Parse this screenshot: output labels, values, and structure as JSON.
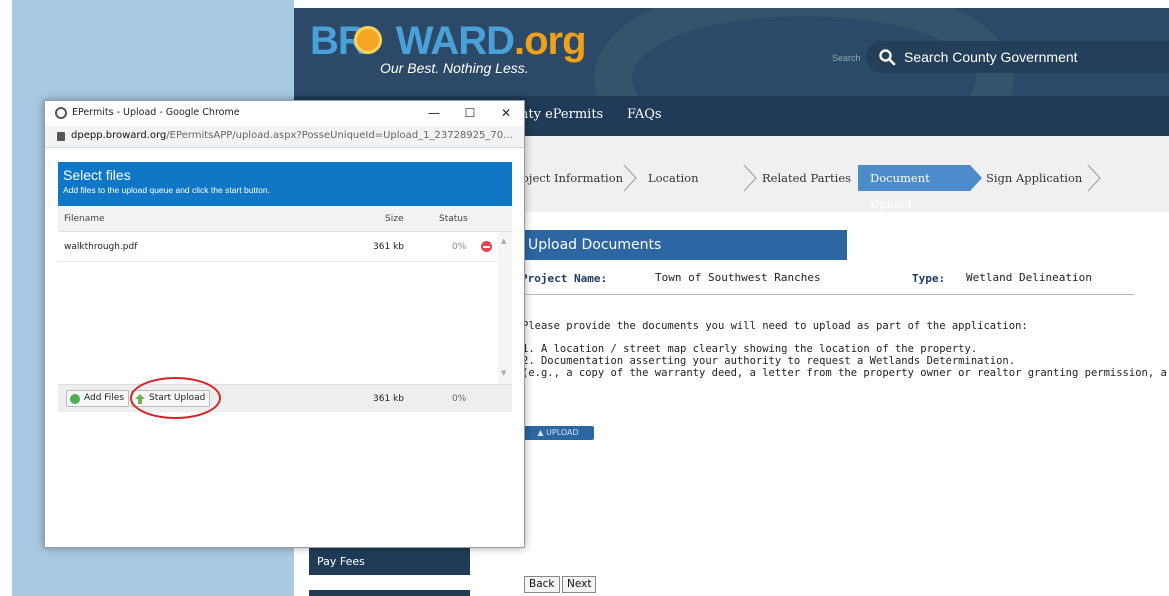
{
  "site": {
    "logo_main": "BR",
    "logo_mid": "WARD",
    "logo_org": ".org",
    "tagline": "Our Best. Nothing Less.",
    "search_small": "Search",
    "search_placeholder": "Search County Government"
  },
  "nav": {
    "epermits": "nty ePermits",
    "faqs": "FAQs"
  },
  "steps": [
    {
      "label": "oject Information",
      "active": false
    },
    {
      "label": "Location",
      "active": false
    },
    {
      "label": "Related Parties",
      "active": false
    },
    {
      "label": "Document Upload",
      "active": true
    },
    {
      "label": "Sign Application",
      "active": false
    }
  ],
  "main": {
    "section_title": "Upload Documents",
    "project_label": "Project Name:",
    "project_value": "Town of Southwest Ranches",
    "type_label": "Type:",
    "type_value": "Wetland Delineation",
    "intro": "Please provide the documents you will need to upload as part of the application:",
    "item1": "1. A location / street map clearly showing the location of the property.",
    "item2": "2. Documentation asserting your authority to request a Wetlands Determination.",
    "item3": "(e.g., a copy of the warranty deed, a letter from the property owner or realtor granting permission, a copy of a contract, etc.)",
    "upload_button": "▲ UPLOAD",
    "back": "Back",
    "next": "Next"
  },
  "sidebar": {
    "pay_fees": "Pay Fees"
  },
  "popup": {
    "window_title": "EPermits - Upload - Google Chrome",
    "minimize": "—",
    "maximize": "☐",
    "close": "✕",
    "url_domain": "dpepp.broward.org",
    "url_rest": "/EPermitsAPP/upload.aspx?PosseUniqueId=Upload_1_23728925_70...",
    "header_title": "Select files",
    "header_sub": "Add files to the upload queue and click the start button.",
    "col_filename": "Filename",
    "col_size": "Size",
    "col_status": "Status",
    "files": [
      {
        "name": "walkthrough.pdf",
        "size": "361 kb",
        "status": "0%"
      }
    ],
    "add_files": "Add Files",
    "start_upload": "Start Upload",
    "total_size": "361 kb",
    "total_status": "0%"
  },
  "colors": {
    "header_bg": "#2c4a67",
    "nav_bg": "#1f3b57",
    "active_step": "#4d8ccb",
    "popup_header": "#1077c7",
    "highlight": "#d8232a"
  }
}
